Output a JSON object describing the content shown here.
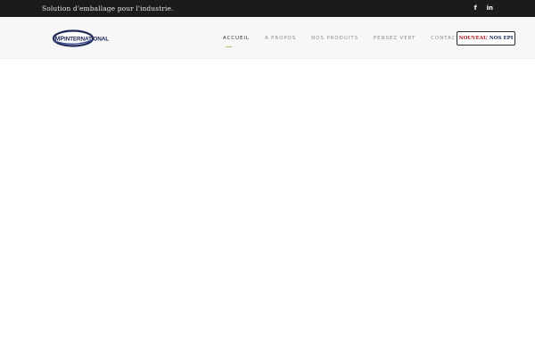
{
  "topbar": {
    "tagline": "Solution d'emballage pour l'industrie.",
    "social": [
      {
        "icon": "facebook-icon",
        "glyph": "f"
      },
      {
        "icon": "linkedin-icon",
        "glyph": "in"
      }
    ]
  },
  "header": {
    "logo": {
      "prefix": "MP",
      "text": "INTERNATIONAL",
      "colors": {
        "primary": "#1f2a5a",
        "swoosh": "#3b4a8c"
      }
    },
    "nav": [
      {
        "label": "ACCUEIL",
        "active": true
      },
      {
        "label": "À PROPOS",
        "active": false
      },
      {
        "label": "NOS PRODUITS",
        "active": false
      },
      {
        "label": "PENSEZ VERT",
        "active": false
      },
      {
        "label": "CONTACT",
        "active": false
      }
    ],
    "cta": {
      "new_label": "NOUVEAU",
      "label": "NOS EPI"
    }
  },
  "colors": {
    "topbar_bg": "#1b1b1b",
    "header_bg": "#f7f7f7",
    "accent_underline": "#c9b36a",
    "cta_new": "#b3181f"
  }
}
